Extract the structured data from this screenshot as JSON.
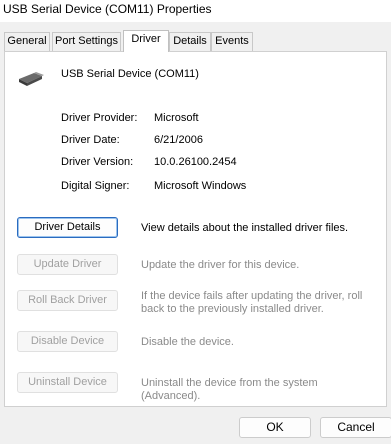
{
  "window": {
    "title": "USB Serial Device (COM11) Properties"
  },
  "tabs": [
    {
      "label": "General",
      "active": false
    },
    {
      "label": "Port Settings",
      "active": false
    },
    {
      "label": "Driver",
      "active": true
    },
    {
      "label": "Details",
      "active": false
    },
    {
      "label": "Events",
      "active": false
    }
  ],
  "device": {
    "name": "USB Serial Device (COM11)",
    "icon": "usb-connector-icon"
  },
  "properties": [
    {
      "label": "Driver Provider:",
      "value": "Microsoft"
    },
    {
      "label": "Driver Date:",
      "value": "6/21/2006"
    },
    {
      "label": "Driver Version:",
      "value": "10.0.26100.2454"
    },
    {
      "label": "Digital Signer:",
      "value": "Microsoft Windows"
    }
  ],
  "actions": [
    {
      "label": "Driver Details",
      "description": "View details about the installed driver files.",
      "enabled": true
    },
    {
      "label": "Update Driver",
      "description": "Update the driver for this device.",
      "enabled": false
    },
    {
      "label": "Roll Back Driver",
      "description": "If the device fails after updating the driver, roll back to the previously installed driver.",
      "enabled": false
    },
    {
      "label": "Disable Device",
      "description": "Disable the device.",
      "enabled": false
    },
    {
      "label": "Uninstall Device",
      "description": "Uninstall the device from the system (Advanced).",
      "enabled": false
    }
  ],
  "footer": {
    "ok_label": "OK",
    "cancel_label": "Cancel"
  },
  "colors": {
    "accent": "#2a6bbf",
    "disabled_text": "#a0a0a0"
  }
}
